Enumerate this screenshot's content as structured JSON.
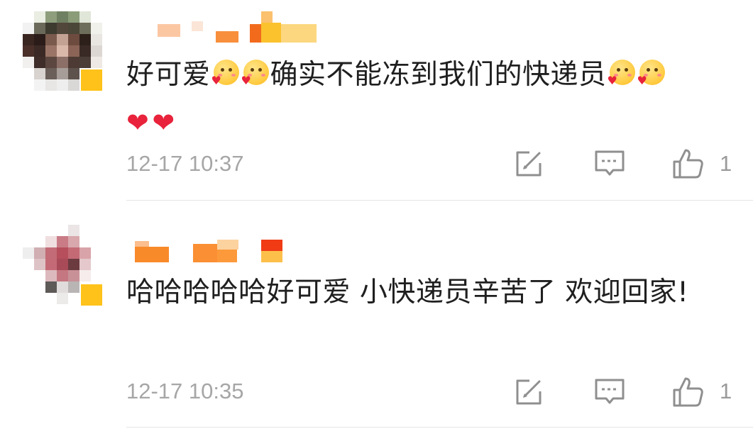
{
  "comments": [
    {
      "username": "",
      "text_segments": [
        {
          "type": "text",
          "value": "好可爱"
        },
        {
          "type": "emoji",
          "name": "shy-blush-emoji"
        },
        {
          "type": "emoji",
          "name": "shy-blush-emoji"
        },
        {
          "type": "text",
          "value": "确实不能冻到我们的快递员"
        },
        {
          "type": "emoji",
          "name": "shy-blush-emoji"
        },
        {
          "type": "emoji",
          "name": "shy-blush-emoji"
        },
        {
          "type": "heart",
          "value": "❤"
        },
        {
          "type": "heart",
          "value": "❤"
        }
      ],
      "timestamp": "12-17 10:37",
      "like_count": "1",
      "icons": {
        "edit": "forward-edit-icon",
        "reply": "comment-bubble-icon",
        "like": "thumbs-up-icon"
      }
    },
    {
      "username": "",
      "text_segments": [
        {
          "type": "text",
          "value": "哈哈哈哈哈好可爱 小快递员辛苦了 欢迎回家!"
        }
      ],
      "timestamp": "12-17 10:35",
      "like_count": "1",
      "icons": {
        "edit": "forward-edit-icon",
        "reply": "comment-bubble-icon",
        "like": "thumbs-up-icon"
      }
    }
  ],
  "colors": {
    "text": "#1f1f1f",
    "meta": "#a6a6a6",
    "heart": "#e8233b",
    "badge": "#ffc21a",
    "icon_stroke": "#8f8f8f"
  }
}
